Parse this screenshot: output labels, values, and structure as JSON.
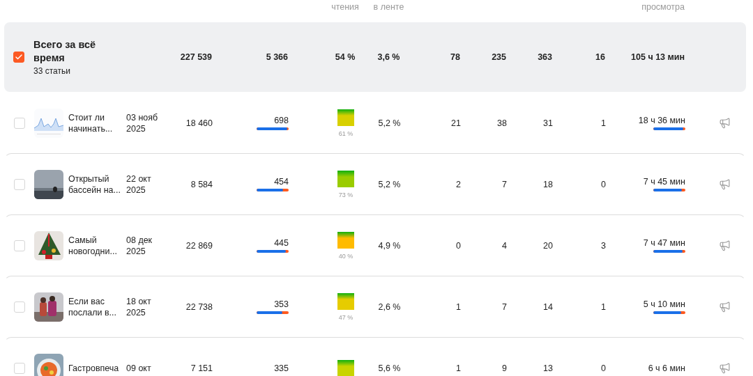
{
  "header": {
    "reading": "чтения",
    "feed": "в ленте",
    "watch": "просмотра"
  },
  "total": {
    "checked": true,
    "title": "Всего за всё время",
    "subtitle": "33 статьи",
    "cells": [
      "227 539",
      "5 366",
      "54 %",
      "3,6 %",
      "78",
      "235",
      "363",
      "16",
      "105 ч 13 мин"
    ]
  },
  "rows": [
    {
      "checked": false,
      "title": "Стоит ли начинать...",
      "date": "03 нояб 2025",
      "views": "18 460",
      "likes": {
        "value": "698",
        "level": 0.95
      },
      "reading": {
        "value": "61 %",
        "color": "#d8d000"
      },
      "feed": "5,2 %",
      "counts": [
        "21",
        "38",
        "31",
        "1"
      ],
      "time": {
        "value": "18 ч 36 мин",
        "level": 0.94
      }
    },
    {
      "checked": false,
      "title": "Открытый бассейн на...",
      "date": "22 окт 2025",
      "views": "8 584",
      "likes": {
        "value": "454",
        "level": 0.83
      },
      "reading": {
        "value": "73 %",
        "color": "#9acc00"
      },
      "feed": "5,2 %",
      "counts": [
        "2",
        "7",
        "18",
        "0"
      ],
      "time": {
        "value": "7 ч 45 мин",
        "level": 0.9
      }
    },
    {
      "checked": false,
      "title": "Самый новогодни...",
      "date": "08 дек 2025",
      "views": "22 869",
      "likes": {
        "value": "445",
        "level": 0.92
      },
      "reading": {
        "value": "40 %",
        "color": "#ffbb00"
      },
      "feed": "4,9 %",
      "counts": [
        "0",
        "4",
        "20",
        "3"
      ],
      "time": {
        "value": "7 ч 47 мин",
        "level": 0.92
      }
    },
    {
      "checked": false,
      "title": "Если вас послали в...",
      "date": "18 окт 2025",
      "views": "22 738",
      "likes": {
        "value": "353",
        "level": 0.8
      },
      "reading": {
        "value": "47 %",
        "color": "#e6cc00"
      },
      "feed": "2,6 %",
      "counts": [
        "1",
        "7",
        "14",
        "1"
      ],
      "time": {
        "value": "5 ч 10 мин",
        "level": 0.88
      }
    },
    {
      "checked": false,
      "title": "Гастровпеча",
      "date": "09 окт",
      "views": "7 151",
      "likes": {
        "value": "335"
      },
      "reading": {
        "color": "#c8d400"
      },
      "feed": "5,6 %",
      "counts": [
        "1",
        "9",
        "13",
        "0"
      ],
      "time": {
        "value": "6 ч 6 мин"
      }
    }
  ]
}
